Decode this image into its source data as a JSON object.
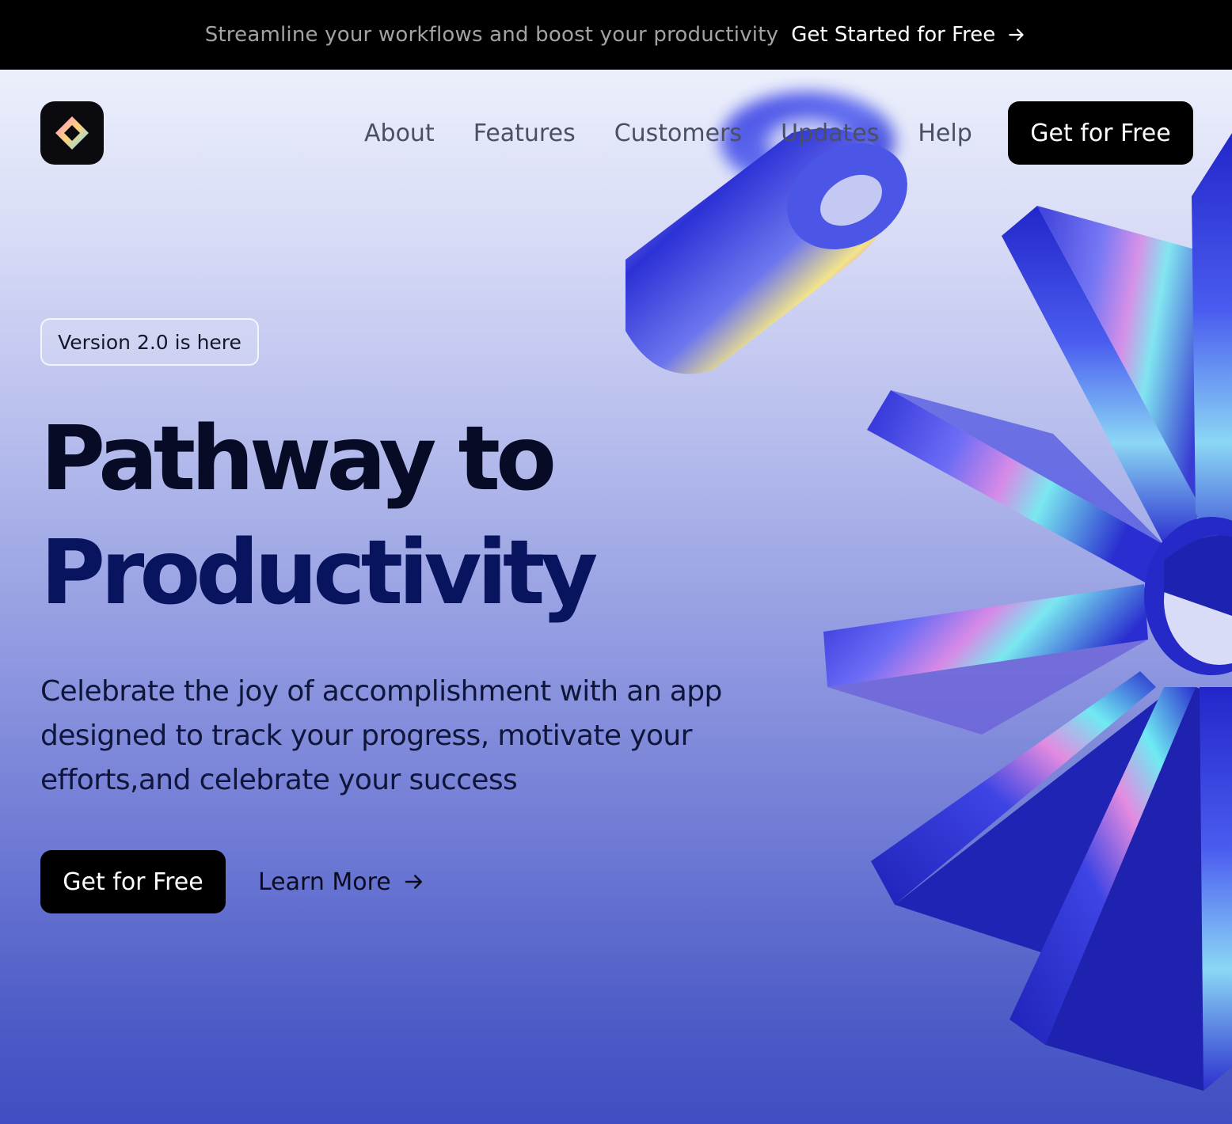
{
  "announcement": {
    "message": "Streamline your workflows and boost your productivity",
    "link_label": "Get Started for Free",
    "link_icon": "arrow-right-icon"
  },
  "header": {
    "logo_icon": "diamond-logo-icon",
    "nav": [
      "About",
      "Features",
      "Customers",
      "Updates",
      "Help"
    ],
    "cta_label": "Get for Free"
  },
  "hero": {
    "badge": "Version 2.0 is here",
    "title_line1": "Pathway to",
    "title_line2": "Productivity",
    "subtitle": "Celebrate the joy of accomplishment with an app designed to track your progress, motivate your efforts,and celebrate your success",
    "primary_cta": "Get for Free",
    "secondary_cta": "Learn More",
    "secondary_icon": "arrow-right-icon"
  },
  "colors": {
    "announcement_bg": "#000000",
    "button_bg": "#000000",
    "button_text": "#FFFFFF",
    "title_line1": "#070B26",
    "title_line2": "#08155E",
    "hero_gradient_top": "#ECEFFB",
    "hero_gradient_bottom": "#3F4FC2"
  }
}
